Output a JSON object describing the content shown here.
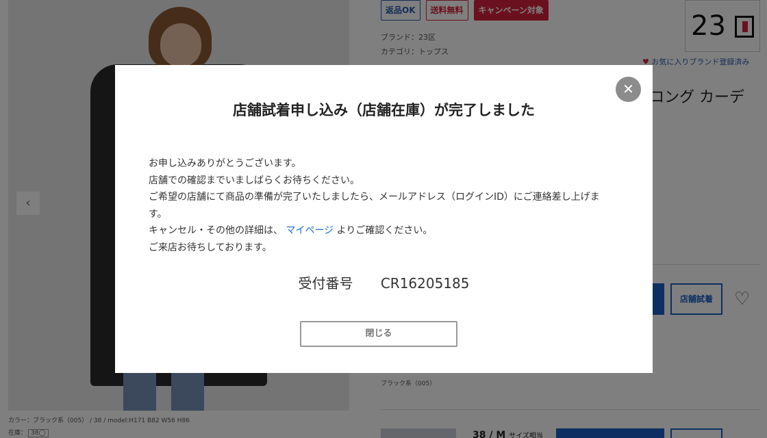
{
  "product": {
    "tags": [
      "返品OK",
      "送料無料",
      "キャンペーン対象"
    ],
    "brand": "ブランド：23区",
    "category": "カテゴリ：トップス",
    "brand_logo": "23",
    "favorite_brand": "お気に入りブランド登録済み",
    "title_peek": "ロング カーデ",
    "store_try_label": "店舗試着",
    "color_name": "ブラック系（005）",
    "size_peek": "38 / M",
    "size_peek_small": "サイズ相当",
    "photo_caption": "カラー：ブラック系（005） / 38 / model:H171 B82 W56 H86",
    "stock_label": "在庫：",
    "stock_size": "38◯"
  },
  "modal": {
    "title": "店舗試着申し込み（店舗在庫）が完了しました",
    "lines": [
      "お申し込みありがとうございます。",
      "店舗での確認までいましばらくお待ちください。",
      "ご希望の店舗にて商品の準備が完了いたしましたら、メールアドレス（ログインID）にご連絡差し上げます。"
    ],
    "cancel_prefix": "キャンセル・その他の詳細は、",
    "mypage_link": "マイページ",
    "cancel_suffix": "よりご確認ください。",
    "closing_line": "ご来店お待ちしております。",
    "receipt_label": "受付番号",
    "receipt_number": "CR16205185",
    "close_button": "閉じる"
  },
  "icons": {
    "close": "close-icon",
    "prev": "chevron-left-icon",
    "heart": "heart-icon"
  },
  "colors": {
    "accent_blue": "#1a5fc4",
    "link_blue": "#1a6fc9",
    "campaign_red": "#d6203c"
  }
}
